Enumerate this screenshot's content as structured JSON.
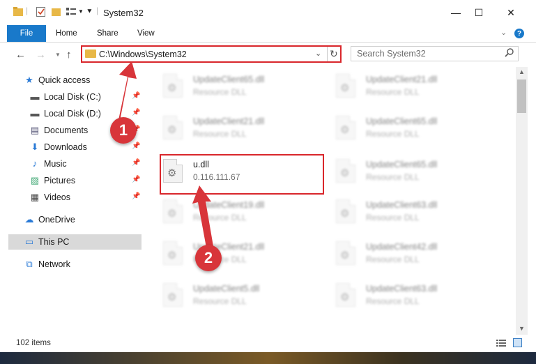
{
  "window": {
    "title": "System32",
    "min_glyph": "—",
    "max_glyph": "☐",
    "close_glyph": "✕"
  },
  "ribbon": {
    "tabs": [
      "File",
      "Home",
      "Share",
      "View"
    ],
    "help_glyph": "?",
    "collapse_glyph": "⌄"
  },
  "address": {
    "path": "C:\\Windows\\System32",
    "search_placeholder": "Search System32"
  },
  "sidebar": {
    "items": [
      {
        "label": "Quick access",
        "icon": "star-icon",
        "pinned": false
      },
      {
        "label": "Local Disk (C:)",
        "icon": "drive-icon",
        "pinned": true
      },
      {
        "label": "Local Disk (D:)",
        "icon": "drive-icon",
        "pinned": true
      },
      {
        "label": "Documents",
        "icon": "documents-icon",
        "pinned": true
      },
      {
        "label": "Downloads",
        "icon": "download-arrow-icon",
        "pinned": true
      },
      {
        "label": "Music",
        "icon": "music-note-icon",
        "pinned": true
      },
      {
        "label": "Pictures",
        "icon": "pictures-icon",
        "pinned": true
      },
      {
        "label": "Videos",
        "icon": "film-icon",
        "pinned": true
      },
      {
        "label": "OneDrive",
        "icon": "cloud-icon",
        "pinned": false
      },
      {
        "label": "This PC",
        "icon": "monitor-icon",
        "pinned": false
      },
      {
        "label": "Network",
        "icon": "network-icon",
        "pinned": false
      }
    ],
    "selected": "This PC"
  },
  "files": {
    "left_column": [
      {
        "name": "UpdateClient65.dll",
        "desc": "Resource DLL",
        "blurred": true
      },
      {
        "name": "UpdateClient21.dll",
        "desc": "Resource DLL",
        "blurred": true
      },
      {
        "name": "u.dll",
        "desc": "0.116.111.67",
        "blurred": false
      },
      {
        "name": "UpdateClient19.dll",
        "desc": "Resource DLL",
        "blurred": true
      },
      {
        "name": "UpdateClient21.dll",
        "desc": "Resource DLL",
        "blurred": true
      },
      {
        "name": "UpdateClient5.dll",
        "desc": "Resource DLL",
        "blurred": true
      }
    ],
    "right_column": [
      {
        "name": "UpdateClient21.dll",
        "desc": "Resource DLL",
        "blurred": true
      },
      {
        "name": "UpdateClient65.dll",
        "desc": "Resource DLL",
        "blurred": true
      },
      {
        "name": "UpdateClient65.dll",
        "desc": "Resource DLL",
        "blurred": true
      },
      {
        "name": "UpdateClient63.dll",
        "desc": "Resource DLL",
        "blurred": true
      },
      {
        "name": "UpdateClient42.dll",
        "desc": "Resource DLL",
        "blurred": true
      },
      {
        "name": "UpdateClient63.dll",
        "desc": "Resource DLL",
        "blurred": true
      }
    ]
  },
  "status": {
    "item_count": "102 items"
  },
  "annotations": {
    "step1": "1",
    "step2": "2",
    "color": "#d8353a"
  }
}
